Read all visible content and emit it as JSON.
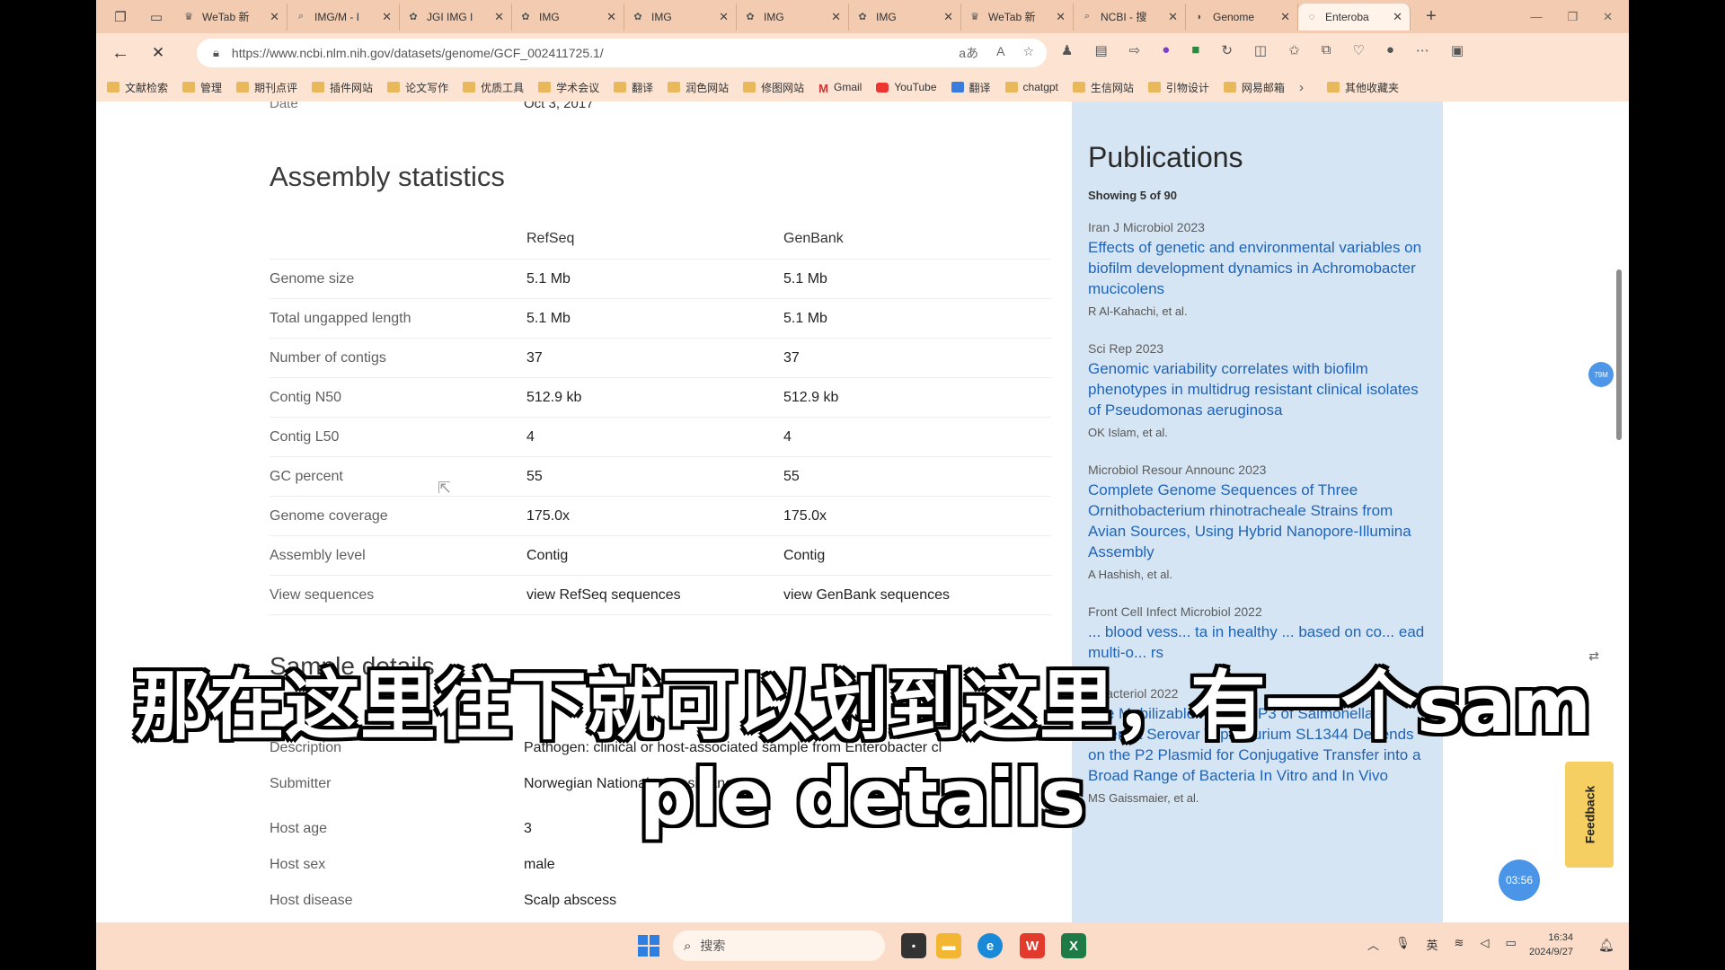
{
  "browser": {
    "tabs": [
      {
        "label": "WeTab 新",
        "icon": "wetab-icon"
      },
      {
        "label": "IMG/M - I",
        "icon": "search-icon"
      },
      {
        "label": "JGI IMG I",
        "icon": "jgi-icon"
      },
      {
        "label": "IMG",
        "icon": "jgi-icon"
      },
      {
        "label": "IMG",
        "icon": "jgi-icon"
      },
      {
        "label": "IMG",
        "icon": "jgi-icon"
      },
      {
        "label": "IMG",
        "icon": "jgi-icon"
      },
      {
        "label": "WeTab 新",
        "icon": "wetab-icon"
      },
      {
        "label": "NCBI - 搜",
        "icon": "search-icon"
      },
      {
        "label": "Genome",
        "icon": "ncbi-icon"
      },
      {
        "label": "Enteroba",
        "icon": "loading-icon"
      }
    ],
    "url": "https://www.ncbi.nlm.nih.gov/datasets/genome/GCF_002411725.1/",
    "bookmarks": [
      "文献检索",
      "管理",
      "期刊点评",
      "插件网站",
      "论文写作",
      "优质工具",
      "学术会议",
      "翻译",
      "润色网站",
      "修图网站",
      "Gmail",
      "YouTube",
      "翻译",
      "chatgpt",
      "生信网站",
      "引物设计",
      "网易邮箱"
    ],
    "other_bookmarks": "其他收藏夹"
  },
  "page": {
    "partial_date_label": "Date",
    "partial_date_value": "Oct 3, 2017",
    "assembly_title": "Assembly statistics",
    "columns": [
      "RefSeq",
      "GenBank"
    ],
    "stats": [
      {
        "label": "Genome size",
        "refseq": "5.1 Mb",
        "genbank": "5.1 Mb"
      },
      {
        "label": "Total ungapped length",
        "refseq": "5.1 Mb",
        "genbank": "5.1 Mb"
      },
      {
        "label": "Number of contigs",
        "refseq": "37",
        "genbank": "37"
      },
      {
        "label": "Contig N50",
        "refseq": "512.9 kb",
        "genbank": "512.9 kb"
      },
      {
        "label": "Contig L50",
        "refseq": "4",
        "genbank": "4"
      },
      {
        "label": "GC percent",
        "refseq": "55",
        "genbank": "55"
      },
      {
        "label": "Genome coverage",
        "refseq": "175.0x",
        "genbank": "175.0x"
      },
      {
        "label": "Assembly level",
        "refseq": "Contig",
        "genbank": "Contig"
      },
      {
        "label": "View sequences",
        "refseq": "view RefSeq sequences",
        "genbank": "view GenBank sequences"
      }
    ],
    "sample_title": "Sample details",
    "sample": [
      {
        "label": "Description",
        "value": "Pathogen: clinical or host-associated sample from Enterobacter cl"
      },
      {
        "label": "Submitter",
        "value": "Norwegian National ... Resistance"
      },
      {
        "label": "Host age",
        "value": "3"
      },
      {
        "label": "Host sex",
        "value": "male"
      },
      {
        "label": "Host disease",
        "value": "Scalp abscess"
      }
    ]
  },
  "publications": {
    "title": "Publications",
    "count": "Showing 5 of 90",
    "items": [
      {
        "meta": "Iran J Microbiol  2023",
        "title": "Effects of genetic and environmental variables on biofilm development dynamics in Achromobacter mucicolens",
        "authors": "R Al-Kahachi, et al."
      },
      {
        "meta": "Sci Rep  2023",
        "title": "Genomic variability correlates with biofilm phenotypes in multidrug resistant clinical isolates of Pseudomonas aeruginosa",
        "authors": "OK Islam, et al."
      },
      {
        "meta": "Microbiol Resour Announc  2023",
        "title": "Complete Genome Sequences of Three Ornithobacterium rhinotracheale Strains from Avian Sources, Using Hybrid Nanopore-Illumina Assembly",
        "authors": "A Hashish, et al."
      },
      {
        "meta": "Front Cell Infect Microbiol  2022",
        "title": "... blood vess... ta in healthy ... based on co... ead multi-o... rs",
        "authors": ""
      },
      {
        "meta": "J Bacteriol  2022",
        "title": "The Mobilizable Plasmid P3 of Salmonella enterica Serovar Typhimurium SL1344 Depends on the P2 Plasmid for Conjugative Transfer into a Broad Range of Bacteria In Vitro and In Vivo",
        "authors": "MS Gaissmaier, et al."
      }
    ]
  },
  "widgets": {
    "float_badge": "79M",
    "feedback": "Feedback",
    "timer": "03:56"
  },
  "subtitle": {
    "line1": "那在这里往下就可以划到这里，有一个sam",
    "line2": "ple details"
  },
  "taskbar": {
    "search_placeholder": "搜索",
    "ime": "英",
    "time": "16:34",
    "date": "2024/9/27"
  }
}
